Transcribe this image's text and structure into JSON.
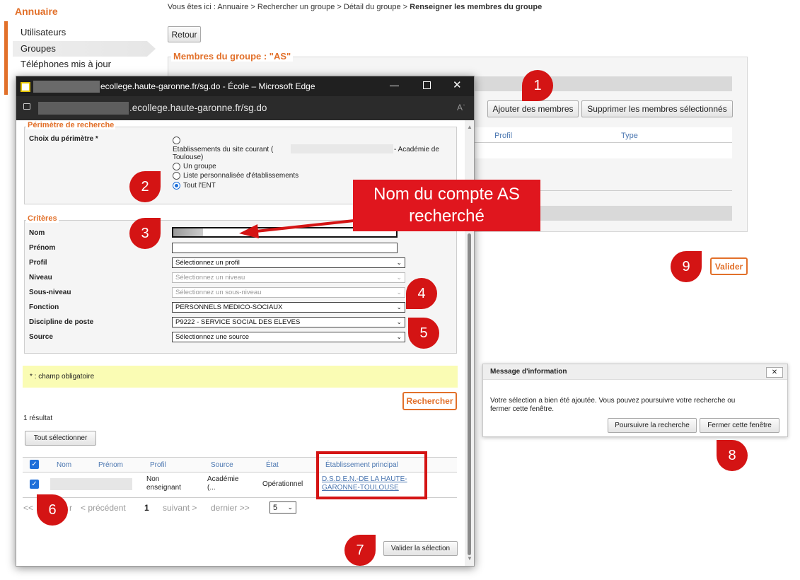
{
  "sidebar": {
    "title": "Annuaire",
    "items": [
      {
        "label": "Utilisateurs"
      },
      {
        "label": "Groupes"
      },
      {
        "label": "Téléphones mis à jour"
      }
    ]
  },
  "breadcrumb": {
    "prefix": "Vous êtes ici : Annuaire > Rechercher un groupe > Détail du groupe > ",
    "current": "Renseigner les membres du groupe"
  },
  "page": {
    "back_label": "Retour",
    "group_legend": "Membres du groupe : \"AS\"",
    "add_members_label": "Ajouter des membres",
    "remove_members_label": "Supprimer les membres sélectionnés",
    "col_profile": "Profil",
    "col_type": "Type",
    "validate_label": "Valider"
  },
  "browser": {
    "title": "ecollege.haute-garonne.fr/sg.do - École – Microsoft Edge",
    "address": ".ecollege.haute-garonne.fr/sg.do",
    "read_aloud": "Aʾ"
  },
  "perimeter": {
    "legend": "Périmètre de recherche",
    "label": "Choix du périmètre *",
    "opt1_prefix": "Etablissements du site courant (",
    "opt1_suffix": "- Académie de",
    "opt1_line2": "Toulouse)",
    "opt2": "Un groupe",
    "opt3": "Liste personnalisée d'établissements",
    "opt4": "Tout l'ENT"
  },
  "criteria": {
    "legend": "Critères",
    "nom": "Nom",
    "prenom": "Prénom",
    "profil": "Profil",
    "profil_value": "Sélectionnez un profil",
    "niveau": "Niveau",
    "niveau_value": "Sélectionnez un niveau",
    "sous_niveau": "Sous-niveau",
    "sous_niveau_value": "Sélectionnez un sous-niveau",
    "fonction": "Fonction",
    "fonction_value": "PERSONNELS MEDICO-SOCIAUX",
    "discipline": "Discipline de poste",
    "discipline_value": "P9222 - SERVICE SOCIAL DES ELEVES",
    "source": "Source",
    "source_value": "Sélectionnez une source"
  },
  "note": "* : champ obligatoire",
  "search_label": "Rechercher",
  "results": {
    "count": "1 résultat",
    "select_all": "Tout sélectionner",
    "columns": [
      "Nom",
      "Prénom",
      "Profil",
      "Source",
      "État",
      "Établissement principal"
    ],
    "row": {
      "profil_l1": "Non",
      "profil_l2": "enseignant",
      "source_l1": "Académie",
      "source_l2": "(...",
      "etat": "Opérationnel",
      "etab_l1": "D.S.D.E.N.-DE LA HAUTE-",
      "etab_l2": "GARONNE-TOULOUSE"
    },
    "pager": {
      "first": "<<",
      "first_tail": "r",
      "prev": "< précédent",
      "page": "1",
      "next": "suivant >",
      "last": "dernier >>",
      "page_size": "5"
    },
    "validate_selection": "Valider la sélection"
  },
  "dialog": {
    "title": "Message d'information",
    "close": "✕",
    "line1": "Votre sélection a bien été ajoutée. Vous pouvez poursuivre votre recherche ou",
    "line2": "fermer cette fenêtre.",
    "continue_label": "Poursuivre la recherche",
    "close_label": "Fermer cette fenêtre"
  },
  "callout": {
    "line1": "Nom du compte AS",
    "line2": "recherché"
  },
  "markers": [
    "1",
    "2",
    "3",
    "4",
    "5",
    "6",
    "7",
    "8",
    "9"
  ],
  "colors": {
    "accent": "#e2702a",
    "annotation": "#d41414",
    "link": "#4a76b0",
    "note_bg": "#fafcb4"
  }
}
